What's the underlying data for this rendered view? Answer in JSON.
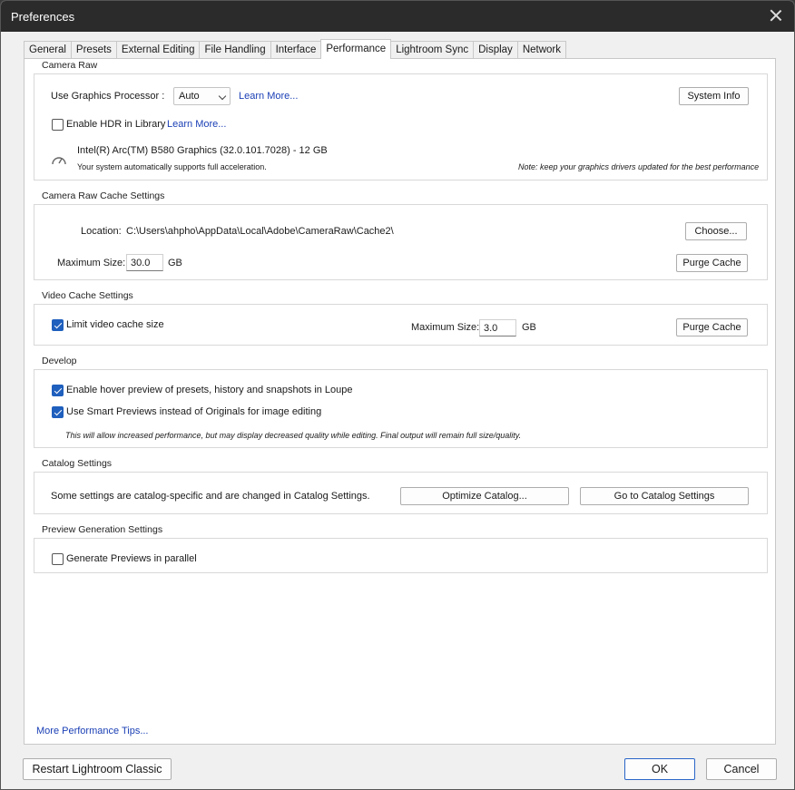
{
  "window": {
    "title": "Preferences"
  },
  "tabs": [
    {
      "label": "General"
    },
    {
      "label": "Presets"
    },
    {
      "label": "External Editing"
    },
    {
      "label": "File Handling"
    },
    {
      "label": "Interface"
    },
    {
      "label": "Performance",
      "active": true
    },
    {
      "label": "Lightroom Sync"
    },
    {
      "label": "Display"
    },
    {
      "label": "Network"
    }
  ],
  "camera_raw": {
    "title": "Camera Raw",
    "gpu_label": "Use Graphics Processor :",
    "gpu_value": "Auto",
    "learn_more_1": "Learn More...",
    "system_info_button": "System Info",
    "hdr_label": "Enable HDR in Library",
    "hdr_checked": false,
    "learn_more_2": "Learn More...",
    "gpu_name": "Intel(R) Arc(TM) B580 Graphics (32.0.101.7028) - 12 GB",
    "accel_text": "Your system automatically supports full acceleration.",
    "driver_note": "Note: keep your graphics drivers updated for the best performance"
  },
  "cache": {
    "title": "Camera Raw Cache Settings",
    "location_label": "Location:",
    "location_value": "C:\\Users\\ahpho\\AppData\\Local\\Adobe\\CameraRaw\\Cache2\\",
    "choose_button": "Choose...",
    "max_size_label": "Maximum Size:",
    "max_size_value": "30.0",
    "unit": "GB",
    "purge_button": "Purge Cache"
  },
  "video_cache": {
    "title": "Video Cache Settings",
    "limit_label": "Limit video cache size",
    "limit_checked": true,
    "max_size_label": "Maximum Size:",
    "max_size_value": "3.0",
    "unit": "GB",
    "purge_button": "Purge Cache"
  },
  "develop": {
    "title": "Develop",
    "hover_label": "Enable hover preview of presets, history and snapshots in Loupe",
    "hover_checked": true,
    "smart_label": "Use Smart Previews instead of Originals for image editing",
    "smart_checked": true,
    "note": "This will allow increased performance, but may display decreased quality while editing. Final output will remain full size/quality."
  },
  "catalog": {
    "title": "Catalog Settings",
    "text": "Some settings are catalog-specific and are changed in Catalog Settings.",
    "optimize_button": "Optimize Catalog...",
    "goto_button": "Go to Catalog Settings"
  },
  "preview": {
    "title": "Preview Generation Settings",
    "parallel_label": "Generate Previews in parallel",
    "parallel_checked": false
  },
  "footer": {
    "tips_link": "More Performance Tips...",
    "restart_button": "Restart Lightroom Classic",
    "ok_button": "OK",
    "cancel_button": "Cancel"
  },
  "colors": {
    "link": "#1a3fb5",
    "accent": "#1f5fbd",
    "titlebar": "#2b2b2b"
  }
}
